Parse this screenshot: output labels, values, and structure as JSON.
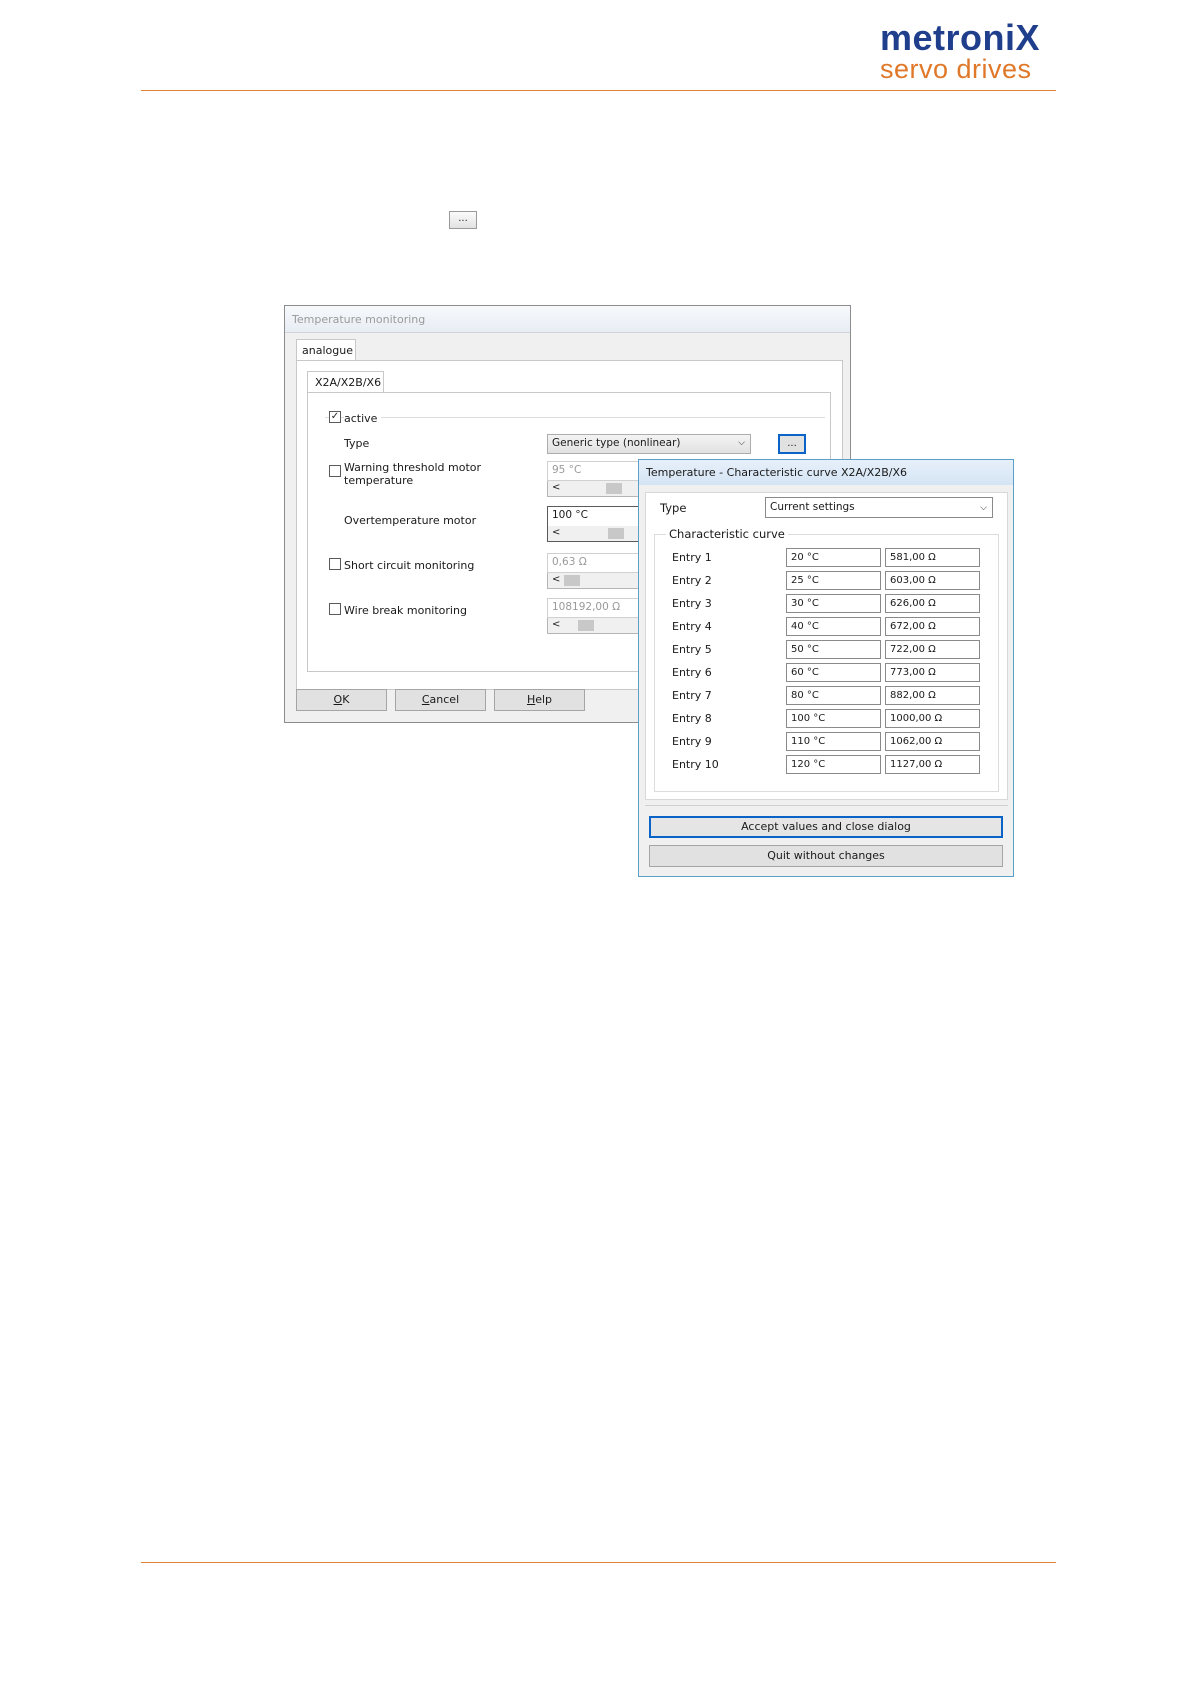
{
  "header": {
    "logo_top": "metroniX",
    "logo_bottom": "servo drives",
    "inline_button_label": "..."
  },
  "temp_dialog": {
    "title": "Temperature monitoring",
    "outer_tab": "analogue",
    "inner_tab": "X2A/X2B/X6",
    "active_label": "active",
    "active_checked": "✓",
    "type_label": "Type",
    "type_value": "Generic type (nonlinear)",
    "type_button": "...",
    "warning_label_1": "Warning threshold motor",
    "warning_label_2": "temperature",
    "warning_value": "95 °C",
    "overtemp_label": "Overtemperature motor",
    "overtemp_value": "100 °C",
    "short_label": "Short circuit monitoring",
    "short_value": "0,63 Ω",
    "wire_label": "Wire break monitoring",
    "wire_value": "108192,00 Ω",
    "scroll_left": "<",
    "ok_prefix": "O",
    "ok_rest": "K",
    "cancel_prefix": "C",
    "cancel_rest": "ancel",
    "help_prefix": "H",
    "help_rest": "elp"
  },
  "curve_dialog": {
    "title": "Temperature - Characteristic curve X2A/X2B/X6",
    "type_label": "Type",
    "type_value": "Current settings",
    "group_label": "Characteristic curve",
    "entries": [
      {
        "label": "Entry 1",
        "temp": "20 °C",
        "res": "581,00 Ω"
      },
      {
        "label": "Entry 2",
        "temp": "25 °C",
        "res": "603,00 Ω"
      },
      {
        "label": "Entry 3",
        "temp": "30 °C",
        "res": "626,00 Ω"
      },
      {
        "label": "Entry 4",
        "temp": "40 °C",
        "res": "672,00 Ω"
      },
      {
        "label": "Entry 5",
        "temp": "50 °C",
        "res": "722,00 Ω"
      },
      {
        "label": "Entry 6",
        "temp": "60 °C",
        "res": "773,00 Ω"
      },
      {
        "label": "Entry 7",
        "temp": "80 °C",
        "res": "882,00 Ω"
      },
      {
        "label": "Entry 8",
        "temp": "100 °C",
        "res": "1000,00 Ω"
      },
      {
        "label": "Entry 9",
        "temp": "110 °C",
        "res": "1062,00 Ω"
      },
      {
        "label": "Entry 10",
        "temp": "120 °C",
        "res": "1127,00 Ω"
      }
    ],
    "accept_button": "Accept values and close dialog",
    "quit_button": "Quit without changes"
  },
  "colors": {
    "brand_blue": "#1f3e8c",
    "brand_orange": "#e0782a",
    "focus_blue": "#0a64c8"
  }
}
